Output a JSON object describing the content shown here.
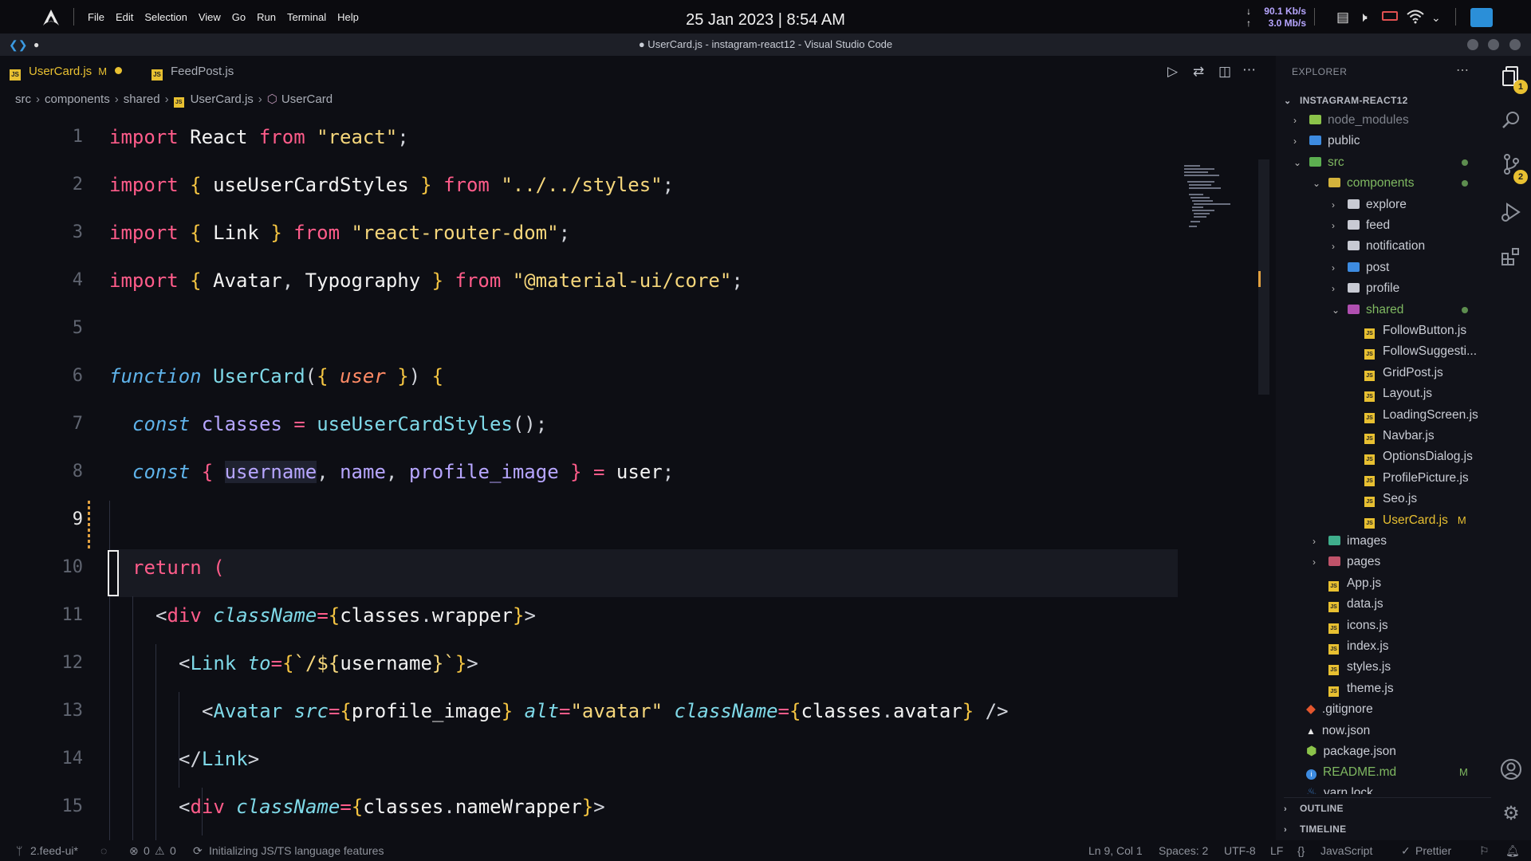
{
  "system": {
    "menu": [
      "File",
      "Edit",
      "Selection",
      "View",
      "Go",
      "Run",
      "Terminal",
      "Help"
    ],
    "clock": "25 Jan 2023 | 8:54 AM",
    "net_down": "90.1 Kb/s",
    "net_up": "3.0 Mb/s",
    "logo_icon": "arch-logo-icon",
    "tray_icons": [
      "clipboard-icon",
      "volume-icon",
      "battery-icon",
      "wifi-icon",
      "chevron-down-icon"
    ]
  },
  "window": {
    "title": "● UserCard.js - instagram-react12 - Visual Studio Code",
    "dot": "●"
  },
  "tabs": [
    {
      "label": "UserCard.js",
      "badge": "M",
      "active": true,
      "modified": true
    },
    {
      "label": "FeedPost.js",
      "active": false
    }
  ],
  "breadcrumb": [
    "src",
    "components",
    "shared",
    "UserCard.js",
    "UserCard"
  ],
  "code": {
    "line_numbers": [
      "1",
      "2",
      "3",
      "4",
      "5",
      "6",
      "7",
      "8",
      "9",
      "10",
      "11",
      "12",
      "13",
      "14",
      "15"
    ],
    "current_line": "9"
  },
  "explorer": {
    "title": "EXPLORER",
    "project": "INSTAGRAM-REACT12",
    "items": [
      {
        "label": "node_modules"
      },
      {
        "label": "public"
      },
      {
        "label": "src"
      },
      {
        "label": "components"
      },
      {
        "label": "explore"
      },
      {
        "label": "feed"
      },
      {
        "label": "notification"
      },
      {
        "label": "post"
      },
      {
        "label": "profile"
      },
      {
        "label": "shared"
      },
      {
        "label": "FollowButton.js"
      },
      {
        "label": "FollowSuggesti..."
      },
      {
        "label": "GridPost.js"
      },
      {
        "label": "Layout.js"
      },
      {
        "label": "LoadingScreen.js"
      },
      {
        "label": "Navbar.js"
      },
      {
        "label": "OptionsDialog.js"
      },
      {
        "label": "ProfilePicture.js"
      },
      {
        "label": "Seo.js"
      },
      {
        "label": "UserCard.js",
        "badge": "M"
      },
      {
        "label": "images"
      },
      {
        "label": "pages"
      },
      {
        "label": "App.js"
      },
      {
        "label": "data.js"
      },
      {
        "label": "icons.js"
      },
      {
        "label": "index.js"
      },
      {
        "label": "styles.js"
      },
      {
        "label": "theme.js"
      },
      {
        "label": ".gitignore"
      },
      {
        "label": "now.json"
      },
      {
        "label": "package.json"
      },
      {
        "label": "README.md",
        "badge": "M"
      },
      {
        "label": "yarn.lock"
      }
    ],
    "outline": "OUTLINE",
    "timeline": "TIMELINE"
  },
  "activity": {
    "explorer_badge": "1",
    "scm_badge": "2"
  },
  "status": {
    "branch": "2.feed-ui*",
    "problems": "0",
    "warnings": "0",
    "task": "Initializing JS/TS language features",
    "position": "Ln 9, Col 1",
    "spaces": "Spaces: 2",
    "encoding": "UTF-8",
    "eol": "LF",
    "language": "JavaScript",
    "formatter": "Prettier"
  },
  "colors": {
    "accent": "#e8c031",
    "keyword": "#ff5c8a",
    "string": "#f5d67b",
    "function": "#7fd9e8",
    "variable": "#b7a6ff"
  }
}
